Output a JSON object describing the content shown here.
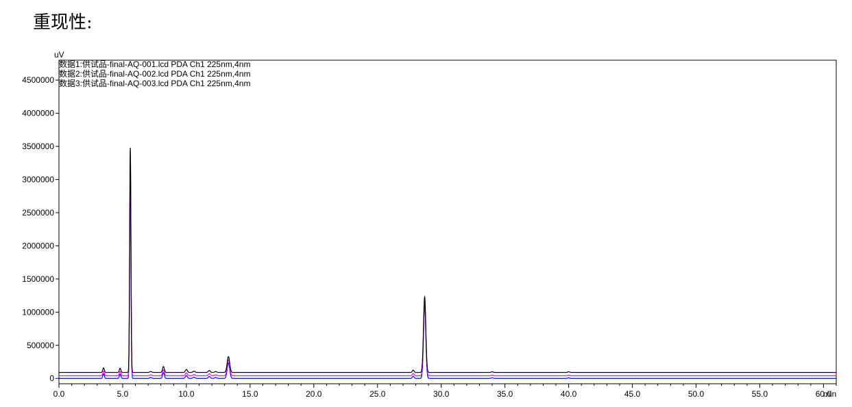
{
  "heading": "重现性:",
  "chart_data": {
    "type": "line",
    "y_unit": "uV",
    "x_unit": "min",
    "xlim": [
      0,
      61
    ],
    "ylim": [
      -80000,
      4800000
    ],
    "x_ticks": [
      0,
      5,
      10,
      15,
      20,
      25,
      30,
      35,
      40,
      45,
      50,
      55,
      60
    ],
    "x_tick_labels": [
      "0.0",
      "5.0",
      "10.0",
      "15.0",
      "20.0",
      "25.0",
      "30.0",
      "35.0",
      "40.0",
      "45.0",
      "50.0",
      "55.0",
      "60.0"
    ],
    "y_ticks": [
      0,
      500000,
      1000000,
      1500000,
      2000000,
      2500000,
      3000000,
      3500000,
      4000000,
      4500000
    ],
    "y_tick_labels": [
      "0",
      "500000",
      "1000000",
      "1500000",
      "2000000",
      "2500000",
      "3000000",
      "3500000",
      "4000000",
      "4500000"
    ],
    "grid": false,
    "legend_position": "top-left",
    "peaks": [
      {
        "rt": 3.5,
        "height": 70000,
        "width": 0.06
      },
      {
        "rt": 4.8,
        "height": 65000,
        "width": 0.06
      },
      {
        "rt": 5.6,
        "height": 3390000,
        "width": 0.05
      },
      {
        "rt": 7.2,
        "height": 15000,
        "width": 0.08
      },
      {
        "rt": 8.2,
        "height": 90000,
        "width": 0.07
      },
      {
        "rt": 10.0,
        "height": 45000,
        "width": 0.08
      },
      {
        "rt": 10.6,
        "height": 20000,
        "width": 0.08
      },
      {
        "rt": 11.8,
        "height": 30000,
        "width": 0.08
      },
      {
        "rt": 12.3,
        "height": 15000,
        "width": 0.08
      },
      {
        "rt": 13.3,
        "height": 240000,
        "width": 0.1
      },
      {
        "rt": 27.8,
        "height": 35000,
        "width": 0.07
      },
      {
        "rt": 28.7,
        "height": 1140000,
        "width": 0.09
      },
      {
        "rt": 34.0,
        "height": 10000,
        "width": 0.08
      },
      {
        "rt": 40.0,
        "height": 10000,
        "width": 0.08
      }
    ],
    "series": [
      {
        "name": "数据1:供试品-final-AQ-001.lcd PDA Ch1 225nm,4nm",
        "color": "#000000",
        "baseline": 90000,
        "scale": 1.0
      },
      {
        "name": "数据2:供试品-final-AQ-002.lcd PDA Ch1 225nm,4nm",
        "color": "#ff00ff",
        "baseline": 40000,
        "scale": 1.0
      },
      {
        "name": "数据3:供试品-final-AQ-003.lcd PDA Ch1 225nm,4nm",
        "color": "#0000ff",
        "baseline": 0,
        "scale": 0.97
      }
    ]
  }
}
